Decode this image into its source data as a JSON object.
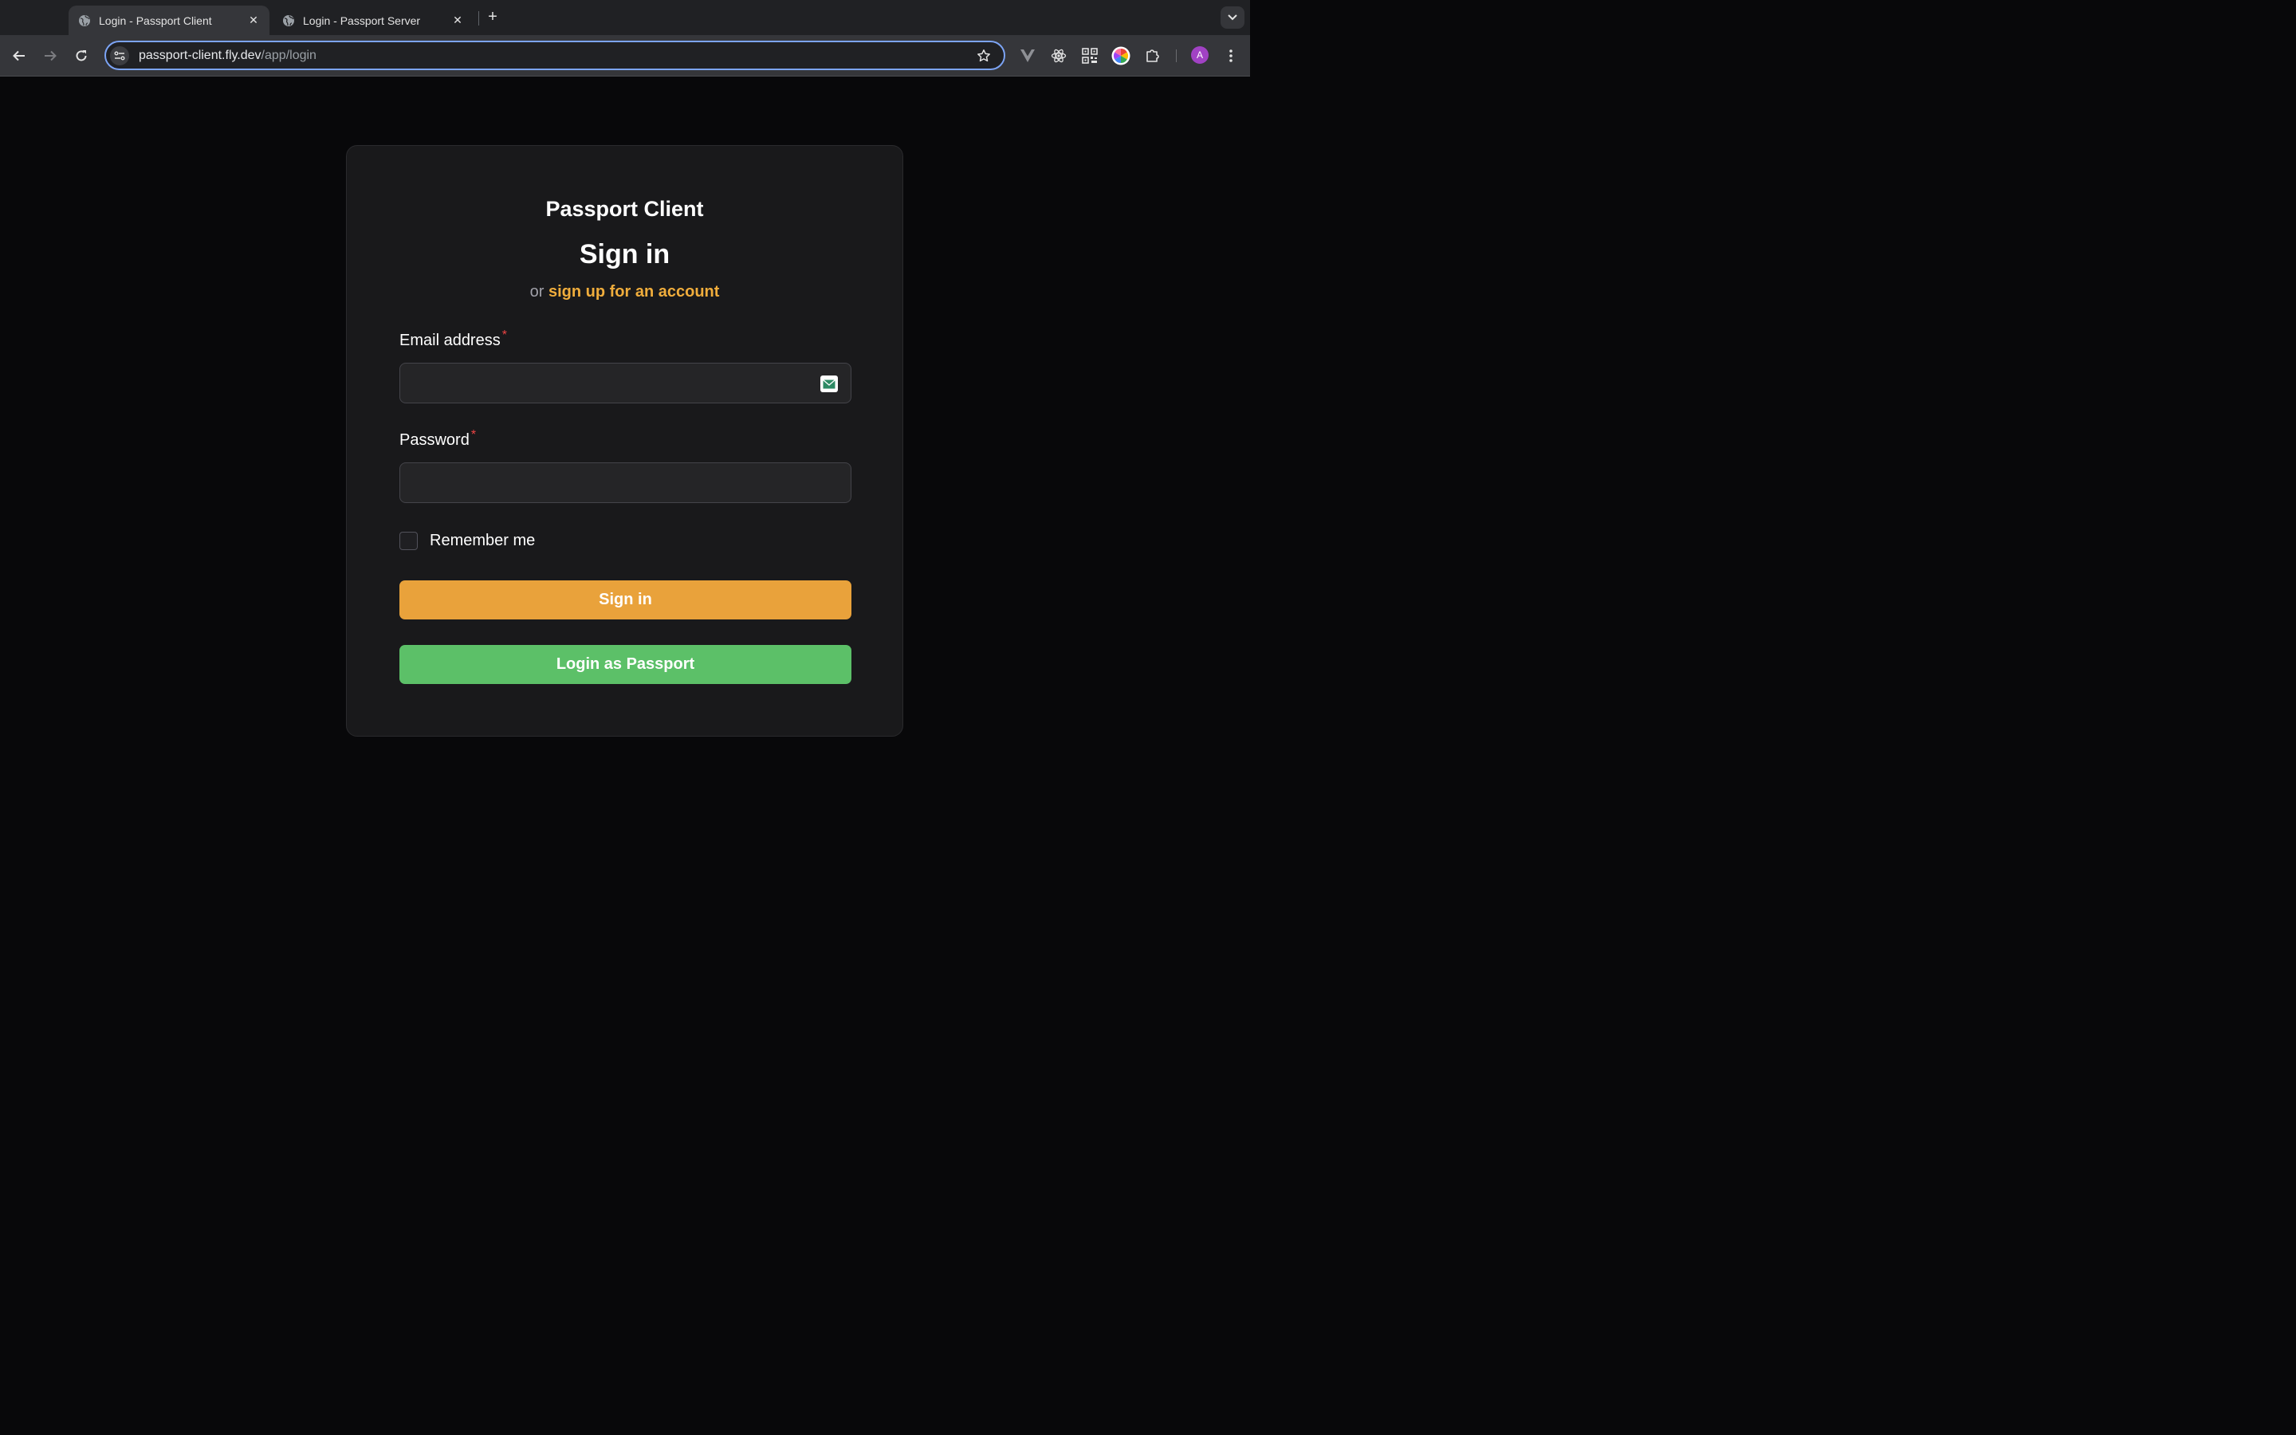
{
  "browser": {
    "tabs": [
      {
        "title": "Login - Passport Client",
        "active": true
      },
      {
        "title": "Login - Passport Server",
        "active": false
      }
    ],
    "url": {
      "host": "passport-client.fly.dev",
      "path": "/app/login"
    },
    "profile_initial": "A"
  },
  "login": {
    "brand": "Passport Client",
    "heading": "Sign in",
    "prompt_prefix": "or",
    "signup_link": "sign up for an account",
    "email_label": "Email address",
    "email_value": "",
    "password_label": "Password",
    "password_value": "",
    "required_marker": "*",
    "remember_label": "Remember me",
    "remember_checked": false,
    "signin_button": "Sign in",
    "passport_button": "Login as Passport"
  },
  "colors": {
    "accent": "#e9a23b",
    "link": "#f0ad3c",
    "passport_green": "#5cc068",
    "required": "#ef4444",
    "page_bg": "#08080a",
    "card_bg": "#19191b"
  }
}
